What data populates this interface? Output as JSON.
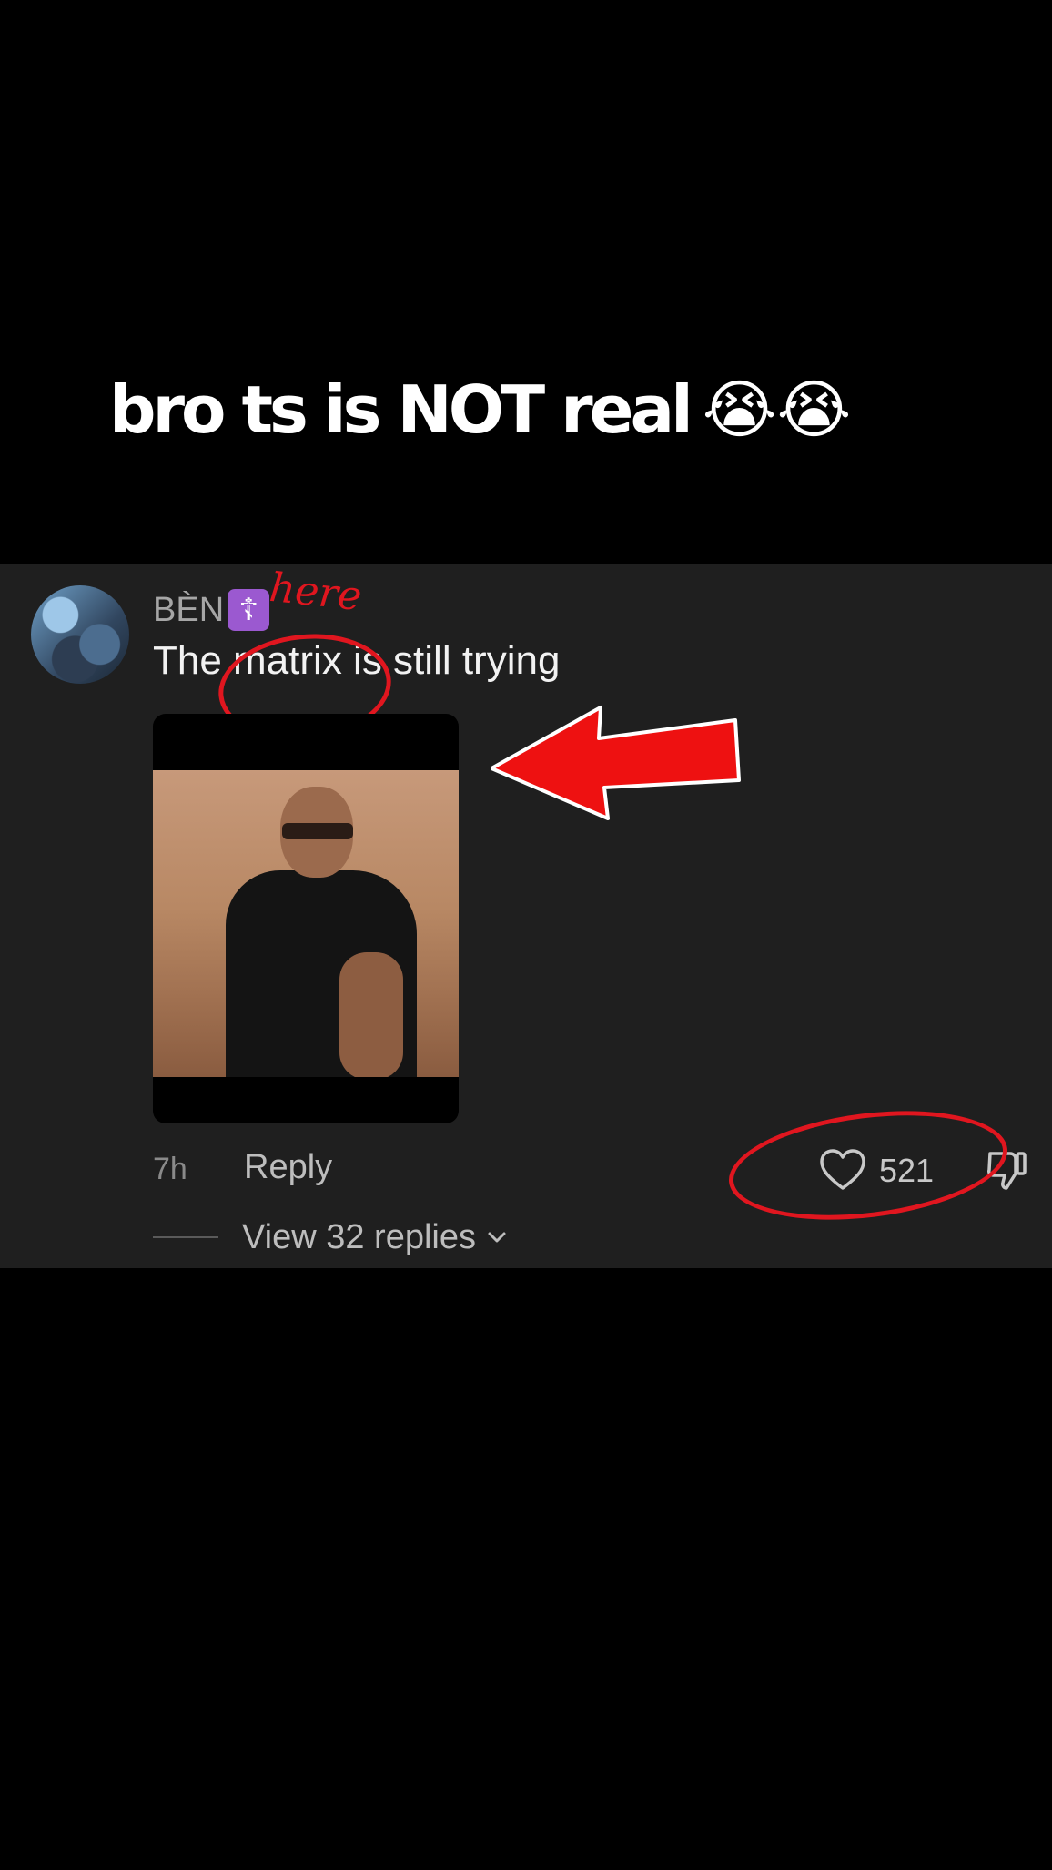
{
  "caption": {
    "text": "bro ts is NOT real",
    "emoji": "😭😭"
  },
  "comment": {
    "username": "BÈN",
    "badge": "☦",
    "text": "The matrix is still trying",
    "time": "7h",
    "reply_label": "Reply",
    "like_count": "521",
    "view_replies_label": "View 32 replies"
  },
  "annotation": {
    "here_text": "here",
    "accent_color": "#e0161f"
  },
  "icons": {
    "heart": "heart-icon",
    "dislike": "thumbs-down-icon",
    "chevron": "chevron-down-icon"
  }
}
